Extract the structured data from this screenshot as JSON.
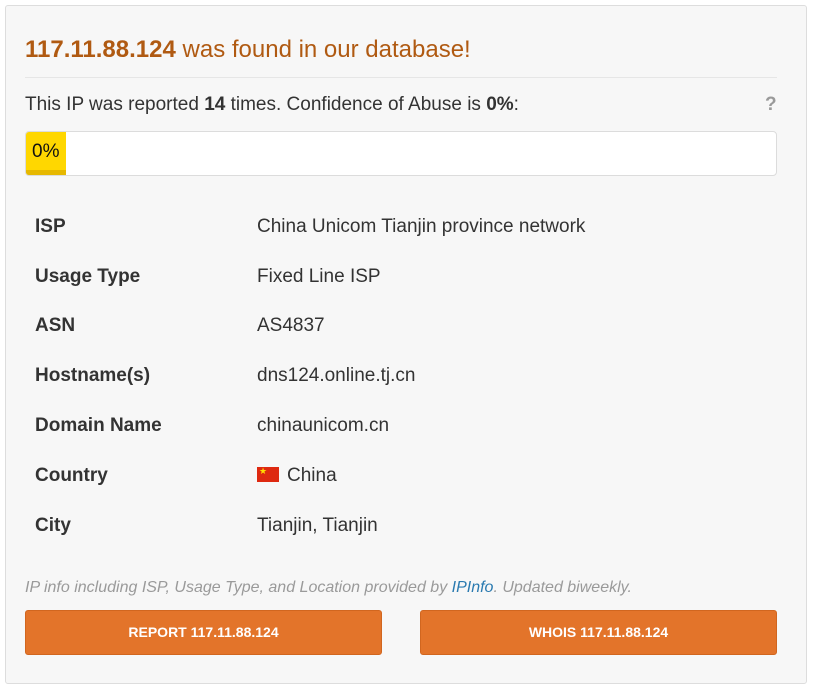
{
  "heading": {
    "ip": "117.11.88.124",
    "suffix": " was found in our database!"
  },
  "report_line": {
    "prefix": "This IP was reported ",
    "count": "14",
    "middle": " times. Confidence of Abuse is ",
    "confidence": "0%",
    "suffix": ":"
  },
  "help": {
    "label": "?"
  },
  "abuse_bar": {
    "label": "0%",
    "value": 0,
    "fill_color": "#ffd700"
  },
  "info_rows": [
    {
      "key": "ISP",
      "value": "China Unicom Tianjin province network"
    },
    {
      "key": "Usage Type",
      "value": "Fixed Line ISP"
    },
    {
      "key": "ASN",
      "value": "AS4837"
    },
    {
      "key": "Hostname(s)",
      "value": "dns124.online.tj.cn"
    },
    {
      "key": "Domain Name",
      "value": "chinaunicom.cn"
    },
    {
      "key": "Country",
      "value": "China",
      "icon": "china-flag-icon"
    },
    {
      "key": "City",
      "value": "Tianjin, Tianjin"
    }
  ],
  "footnote": {
    "prefix": "IP info including ISP, Usage Type, and Location provided by ",
    "link": "IPInfo",
    "suffix": ". Updated biweekly."
  },
  "buttons": {
    "report": "REPORT 117.11.88.124",
    "whois": "WHOIS 117.11.88.124"
  },
  "colors": {
    "heading": "#b05a12",
    "button": "#e3742a",
    "link": "#2a7ab0"
  }
}
